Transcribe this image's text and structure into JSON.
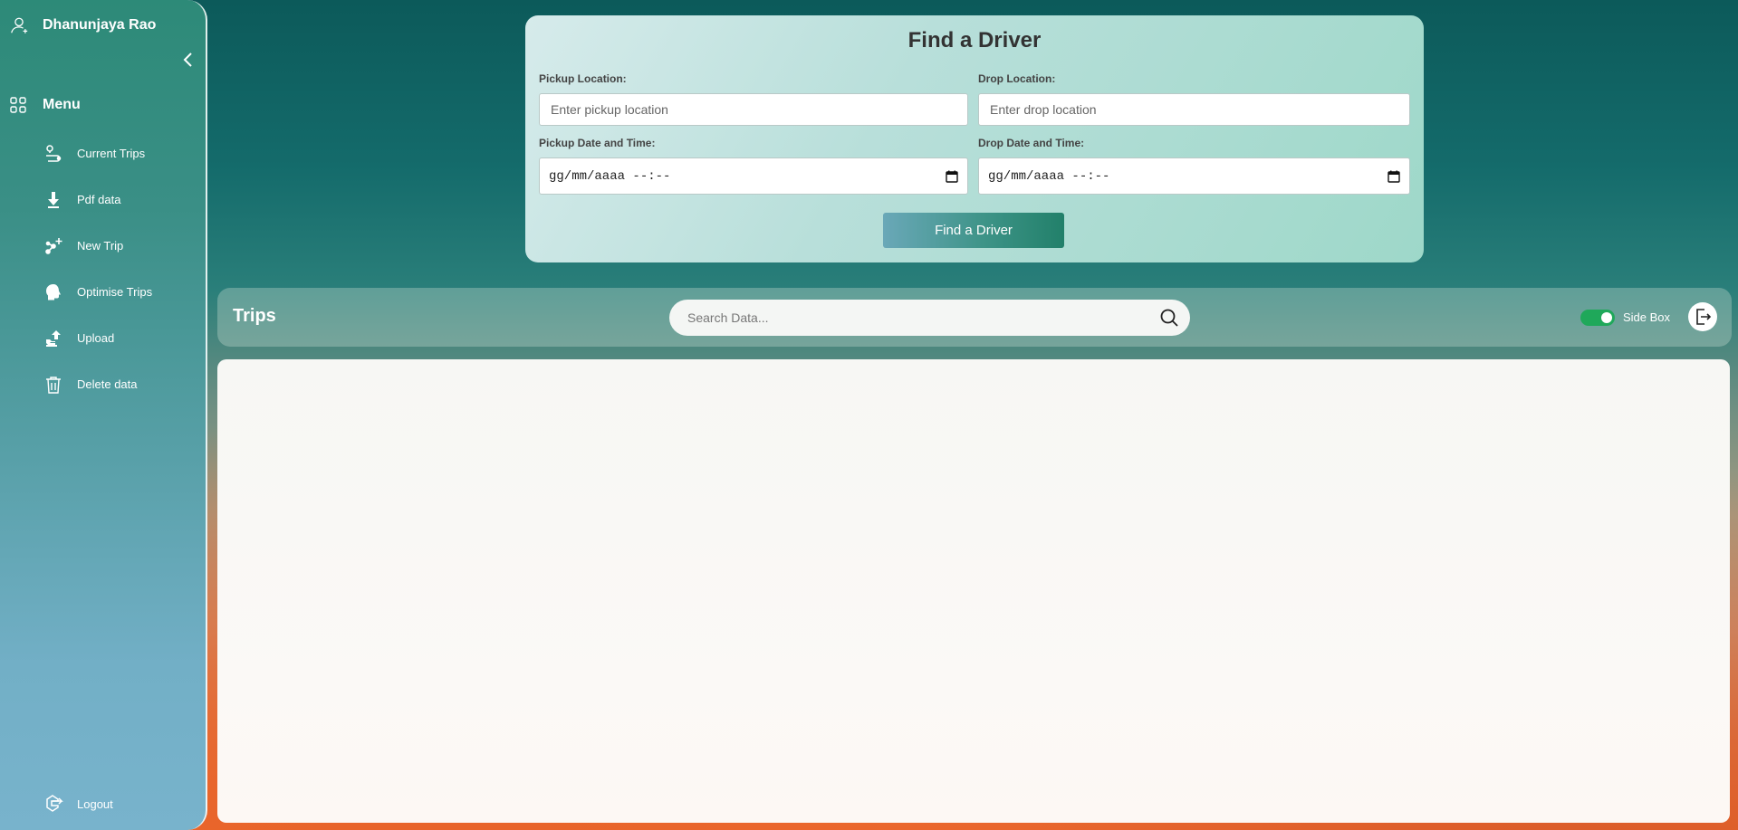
{
  "sidebar": {
    "user_name": "Dhanunjaya Rao",
    "menu_title": "Menu",
    "items": [
      {
        "label": "Current Trips",
        "icon": "route-icon"
      },
      {
        "label": "Pdf data",
        "icon": "download-icon"
      },
      {
        "label": "New Trip",
        "icon": "new-trip-icon"
      },
      {
        "label": "Optimise Trips",
        "icon": "head-icon"
      },
      {
        "label": "Upload",
        "icon": "upload-icon"
      },
      {
        "label": "Delete data",
        "icon": "trash-icon"
      }
    ],
    "logout_label": "Logout"
  },
  "find_driver": {
    "title": "Find a Driver",
    "pickup_label": "Pickup Location:",
    "pickup_placeholder": "Enter pickup location",
    "drop_label": "Drop Location:",
    "drop_placeholder": "Enter drop location",
    "pickup_dt_label": "Pickup Date and Time:",
    "pickup_dt_value": "gg/mm/aaaa --:--",
    "drop_dt_label": "Drop Date and Time:",
    "drop_dt_value": "gg/mm/aaaa --:--",
    "button_label": "Find a Driver"
  },
  "trips_bar": {
    "title": "Trips",
    "search_placeholder": "Search Data...",
    "toggle_label": "Side Box",
    "toggle_on": true
  },
  "colors": {
    "toggle_on": "#1fa85a",
    "button_start": "#6aa8b8",
    "button_end": "#22806a"
  }
}
